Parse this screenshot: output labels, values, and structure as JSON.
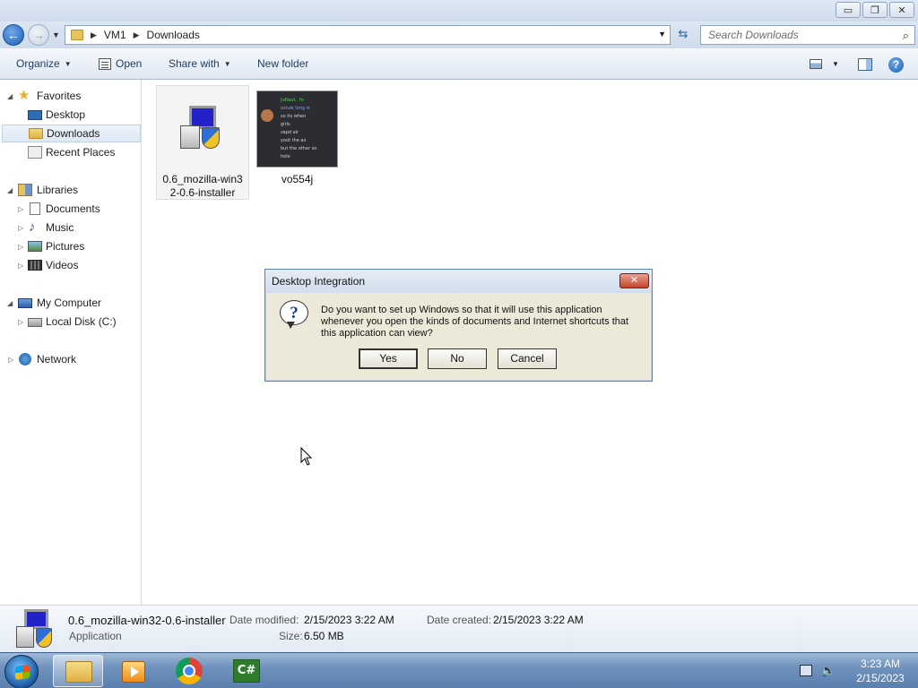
{
  "window": {
    "minimize": "▭",
    "maximize": "❐",
    "close": "✕"
  },
  "address": {
    "crumbs": [
      "VM1",
      "Downloads"
    ],
    "search_placeholder": "Search Downloads"
  },
  "toolbar": {
    "organize": "Organize",
    "open": "Open",
    "share_with": "Share with",
    "new_folder": "New folder",
    "help": "?"
  },
  "nav": {
    "favorites": "Favorites",
    "desktop": "Desktop",
    "downloads": "Downloads",
    "recent_places": "Recent Places",
    "libraries": "Libraries",
    "documents": "Documents",
    "music": "Music",
    "pictures": "Pictures",
    "videos": "Videos",
    "my_computer": "My Computer",
    "local_disk": "Local Disk (C:)",
    "network": "Network"
  },
  "files": [
    {
      "name_line1": "0.6_mozilla-win3",
      "name_line2": "2-0.6-installer",
      "icon": "installer-icon",
      "selected": true
    },
    {
      "name_line1": "vo554j",
      "icon": "image-thumbnail",
      "selected": false
    }
  ],
  "thumbnail_lines": [
    "[eNavi..  fo",
    "ozook  long is",
    "so its when",
    "girls",
    "zapd air",
    "yoot the ax",
    "but the other so",
    "hole"
  ],
  "dialog": {
    "title": "Desktop Integration",
    "close": "✕",
    "message": "Do you want to set up Windows so that it will use this application whenever you open the kinds of documents and Internet shortcuts that this application can view?",
    "yes": "Yes",
    "no": "No",
    "cancel": "Cancel"
  },
  "details": {
    "name": "0.6_mozilla-win32-0.6-installer",
    "type": "Application",
    "date_modified_label": "Date modified:",
    "date_modified": "2/15/2023 3:22 AM",
    "date_created_label": "Date created:",
    "date_created": "2/15/2023 3:22 AM",
    "size_label": "Size:",
    "size": "6.50 MB"
  },
  "taskbar": {
    "csharp_label": "C#",
    "time": "3:23 AM",
    "date": "2/15/2023"
  }
}
